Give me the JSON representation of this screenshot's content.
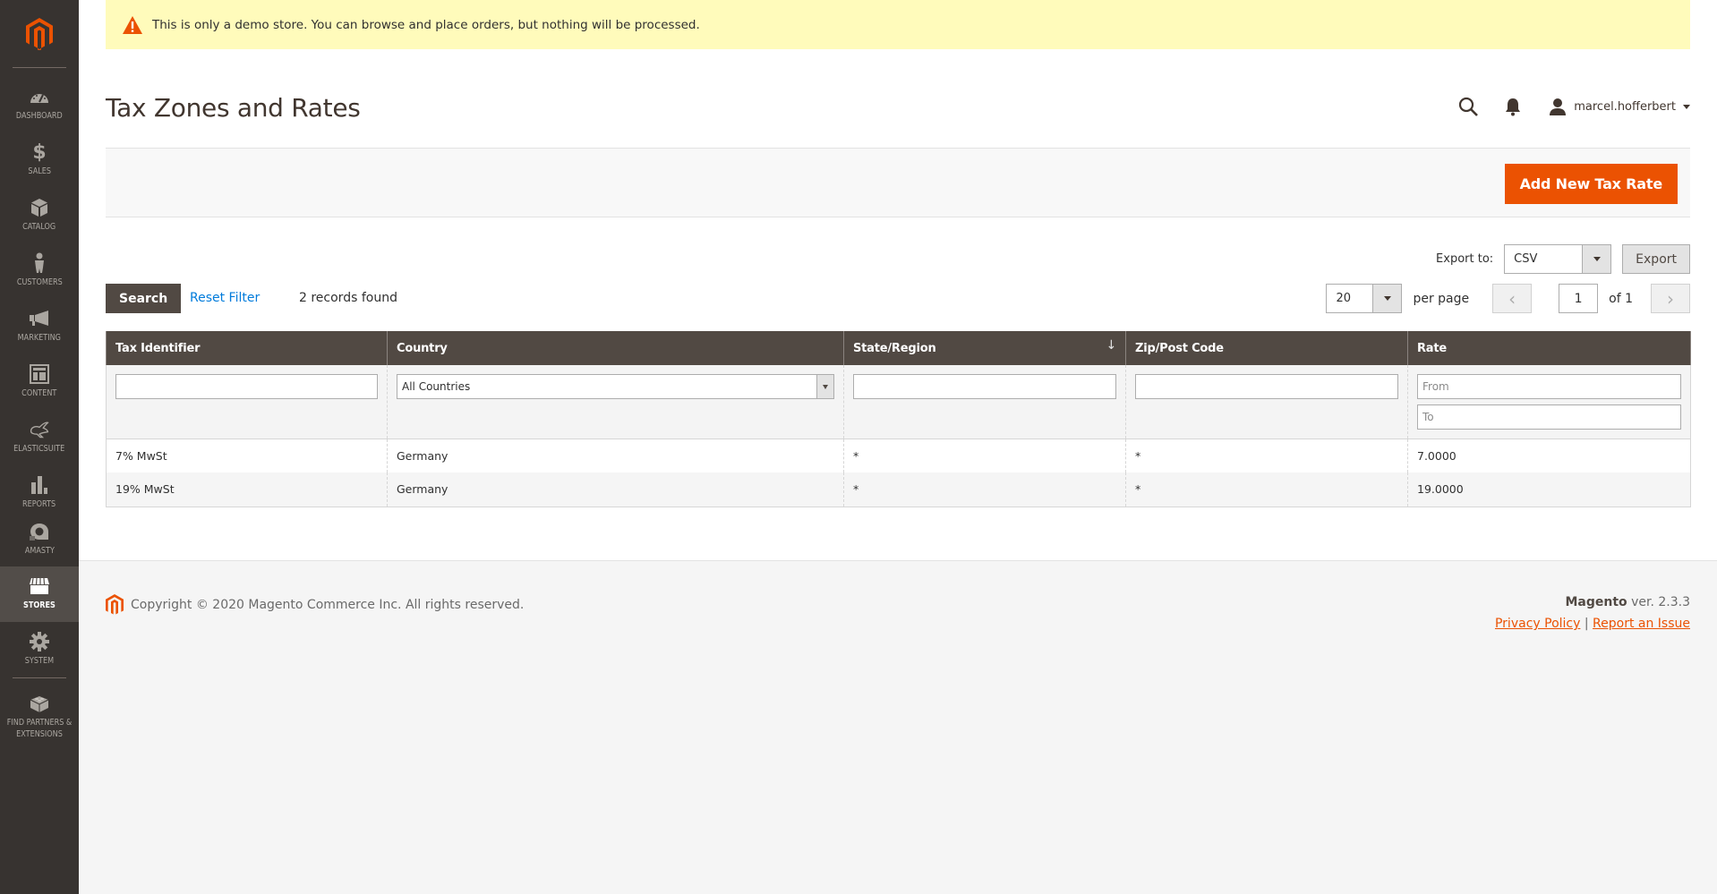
{
  "sidebar": {
    "items": [
      {
        "label": "Dashboard",
        "icon": "dashboard-icon"
      },
      {
        "label": "Sales",
        "icon": "dollar-icon"
      },
      {
        "label": "Catalog",
        "icon": "box-icon"
      },
      {
        "label": "Customers",
        "icon": "person-icon"
      },
      {
        "label": "Marketing",
        "icon": "megaphone-icon"
      },
      {
        "label": "Content",
        "icon": "layout-icon"
      },
      {
        "label": "Elasticsuite",
        "icon": "rabbit-icon"
      },
      {
        "label": "Reports",
        "icon": "bar-chart-icon"
      },
      {
        "label": "Amasty",
        "icon": "amasty-icon"
      },
      {
        "label": "Stores",
        "icon": "store-icon",
        "active": true
      },
      {
        "label": "System",
        "icon": "gear-icon"
      },
      {
        "label": "Find Partners & Extensions",
        "icon": "lego-icon"
      }
    ]
  },
  "banner": {
    "message": "This is only a demo store. You can browse and place orders, but nothing will be processed."
  },
  "header": {
    "title": "Tax Zones and Rates",
    "username": "marcel.hofferbert"
  },
  "actions": {
    "add_new": "Add New Tax Rate"
  },
  "export": {
    "label": "Export to:",
    "format": "CSV",
    "button": "Export"
  },
  "grid": {
    "search_button": "Search",
    "reset_filter": "Reset Filter",
    "records_found": "2 records found",
    "per_page": "20",
    "per_page_label": "per page",
    "current_page": "1",
    "total_pages_label": "of 1",
    "columns": [
      {
        "label": "Tax Identifier"
      },
      {
        "label": "Country"
      },
      {
        "label": "State/Region",
        "sorted": "desc"
      },
      {
        "label": "Zip/Post Code"
      },
      {
        "label": "Rate"
      }
    ],
    "filters": {
      "tax_identifier": "",
      "country": "All Countries",
      "state_region": "",
      "zip": "",
      "rate_from_placeholder": "From",
      "rate_to_placeholder": "To"
    },
    "rows": [
      {
        "tax_identifier": "7% MwSt",
        "country": "Germany",
        "state_region": "*",
        "zip": "*",
        "rate": "7.0000"
      },
      {
        "tax_identifier": "19% MwSt",
        "country": "Germany",
        "state_region": "*",
        "zip": "*",
        "rate": "19.0000"
      }
    ]
  },
  "footer": {
    "copyright": "Copyright © 2020 Magento Commerce Inc. All rights reserved.",
    "brand": "Magento",
    "version": "ver. 2.3.3",
    "privacy_policy": "Privacy Policy",
    "separator": "|",
    "report_issue": "Report an Issue"
  },
  "colors": {
    "brand_orange": "#eb5202",
    "sidebar_bg": "#373330",
    "table_header_bg": "#514943",
    "banner_bg": "#fffbbb",
    "link_blue": "#007bdb"
  }
}
